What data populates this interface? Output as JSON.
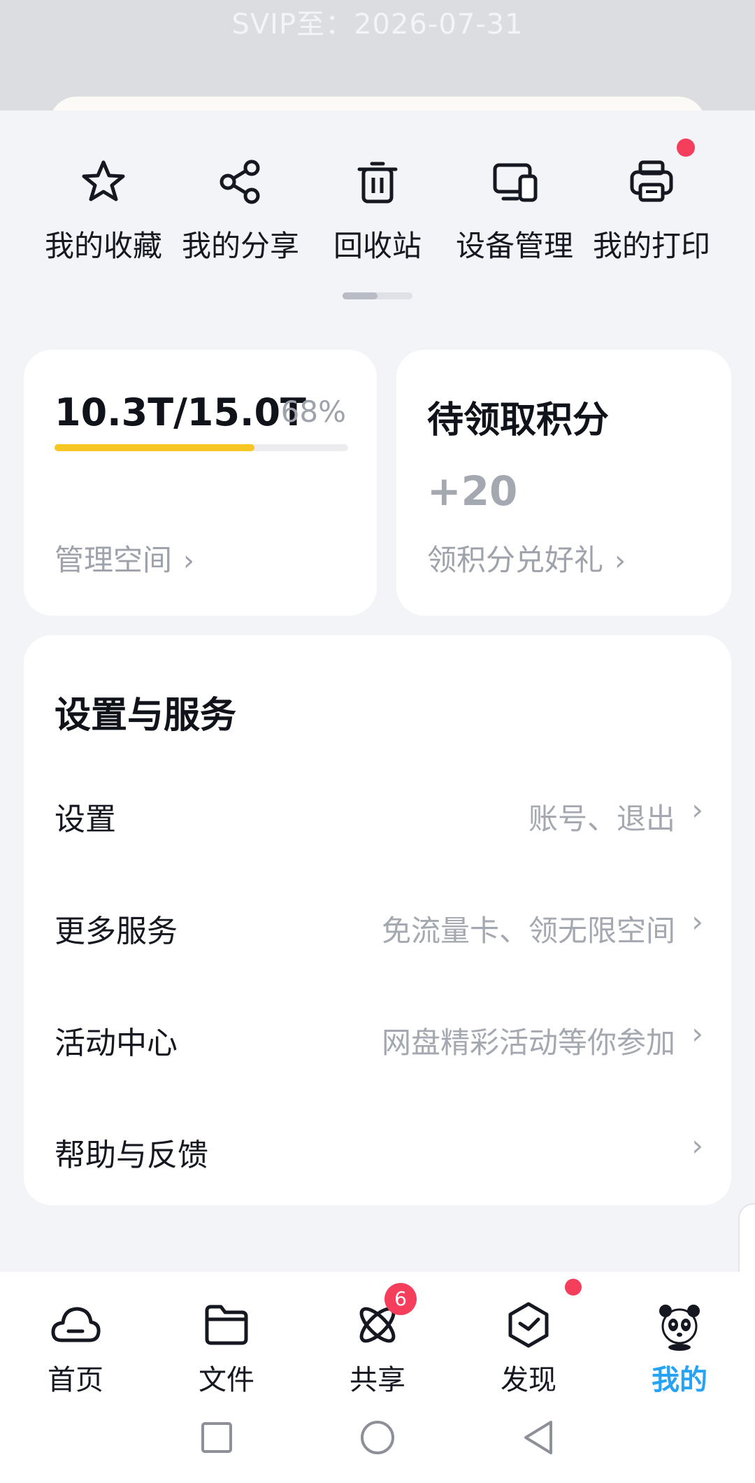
{
  "header": {
    "vip_text": "SVIP至：2026-07-31"
  },
  "quick_actions": [
    {
      "label": "我的收藏",
      "icon": "star-icon"
    },
    {
      "label": "我的分享",
      "icon": "share-icon"
    },
    {
      "label": "回收站",
      "icon": "trash-icon"
    },
    {
      "label": "设备管理",
      "icon": "devices-icon"
    },
    {
      "label": "我的打印",
      "icon": "printer-icon",
      "has_dot": true
    }
  ],
  "storage": {
    "used_label": "10.3T/15.0T",
    "percent_label": "68%",
    "usage_fraction": 0.68,
    "link": "管理空间"
  },
  "points": {
    "title": "待领取积分",
    "value": "+20",
    "link": "领积分兑好礼"
  },
  "services": {
    "title": "设置与服务",
    "rows": [
      {
        "label": "设置",
        "hint": "账号、退出"
      },
      {
        "label": "更多服务",
        "hint": "免流量卡、领无限空间"
      },
      {
        "label": "活动中心",
        "hint": "网盘精彩活动等你参加"
      },
      {
        "label": "帮助与反馈",
        "hint": ""
      }
    ]
  },
  "nav": {
    "items": [
      {
        "label": "首页",
        "icon": "cloud-icon"
      },
      {
        "label": "文件",
        "icon": "folder-icon"
      },
      {
        "label": "共享",
        "icon": "orbit-icon",
        "badge": "6"
      },
      {
        "label": "发现",
        "icon": "discover-icon",
        "has_dot": true
      },
      {
        "label": "我的",
        "icon": "panda-avatar-icon",
        "active": true
      }
    ]
  },
  "colors": {
    "accent": "#27a3f5",
    "progress": "#f8c623",
    "badge": "#f53d5c"
  }
}
